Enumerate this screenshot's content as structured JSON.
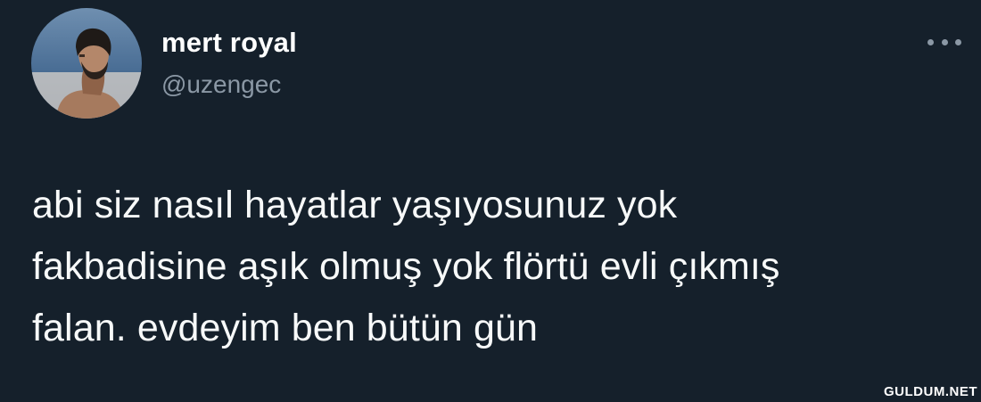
{
  "user": {
    "display_name": "mert royal",
    "handle": "@uzengec",
    "avatar_icon": "profile-photo"
  },
  "more_icon": "more-horizontal-icon",
  "tweet": {
    "text_lines": [
      "abi siz nasıl hayatlar yaşıyosunuz yok",
      "fakbadisine aşık olmuş yok flörtü evli çıkmış",
      "falan. evdeyim ben bütün gün"
    ]
  },
  "watermark": "GULDUM.NET",
  "colors": {
    "background": "#15202b",
    "text": "#f7f9f9",
    "secondary_text": "#8b98a5"
  }
}
